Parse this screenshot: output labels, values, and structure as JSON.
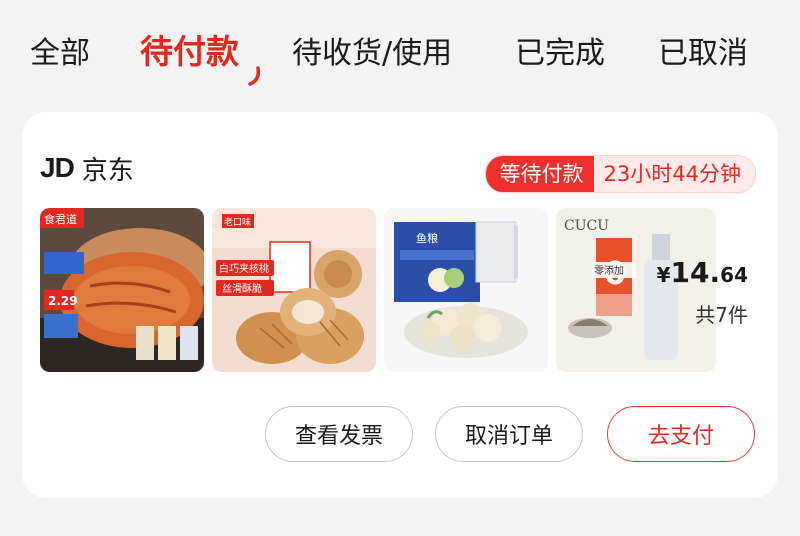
{
  "tabs": [
    {
      "label": "全部"
    },
    {
      "label": "待付款"
    },
    {
      "label": "待收货/使用"
    },
    {
      "label": "已完成"
    },
    {
      "label": "已取消"
    }
  ],
  "order": {
    "shop_logo": "JD",
    "shop_name": "京东",
    "status_label": "等待付款",
    "status_timer": "23小时44分钟",
    "products": [
      {
        "brand_tag": "食君道",
        "promo_price": "2.29",
        "icon": "grilled-chicken-breast-image"
      },
      {
        "brand_tag": "老口味",
        "tag_line_1": "白巧夹核桃",
        "tag_line_2": "丝滑酥脆",
        "icon": "walnut-bun-image"
      },
      {
        "tag_line_1": "鱼粮",
        "icon": "fish-balls-image"
      },
      {
        "brand_tag": "CUCU",
        "tag_line_1": "0",
        "tag_line_2": "零添加",
        "icon": "vinegar-bottle-image"
      }
    ],
    "price_symbol": "¥",
    "price_integer": "14.",
    "price_decimal": "64",
    "item_count": "共7件",
    "actions": {
      "invoice": "查看发票",
      "cancel": "取消订单",
      "pay": "去支付"
    }
  },
  "colors": {
    "accent": "#e4281f",
    "background": "#f3f3f3",
    "card": "#ffffff"
  }
}
